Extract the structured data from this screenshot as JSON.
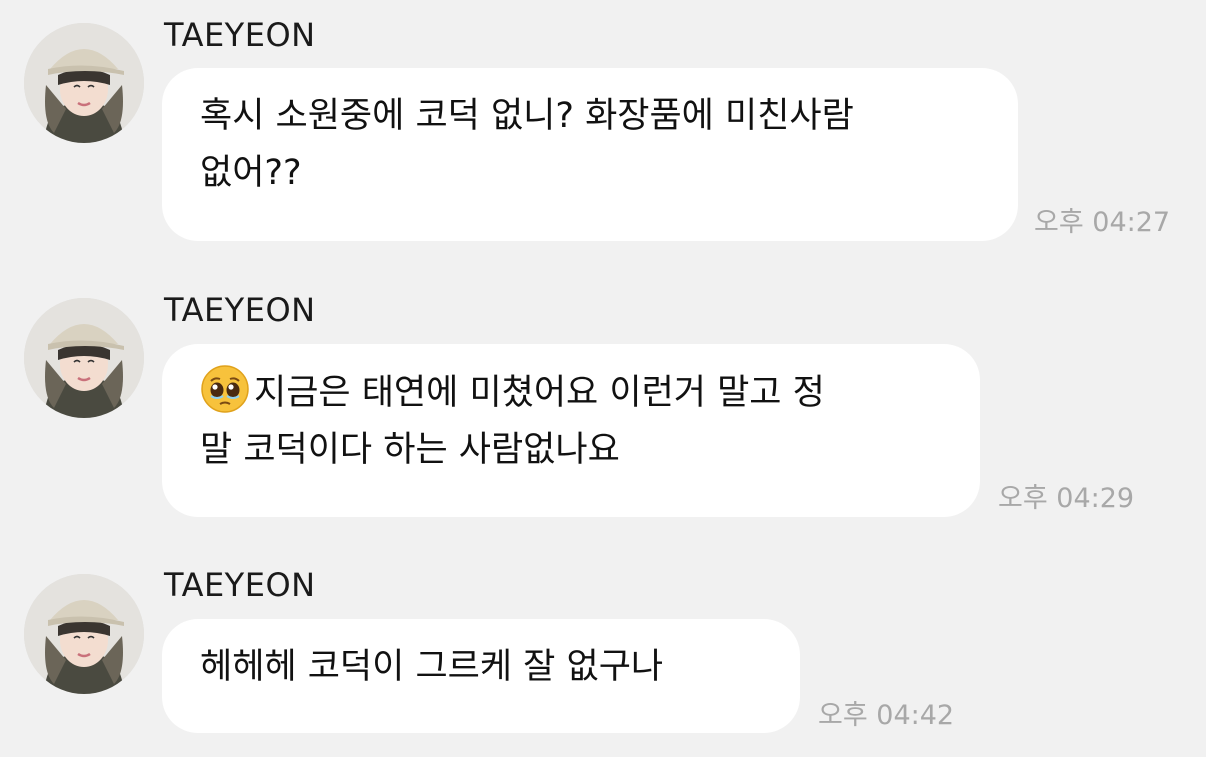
{
  "messages": [
    {
      "sender": "TAEYEON",
      "lines": [
        "혹시 소원중에 코덕 없니? 화장품에 미친사람",
        "없어??"
      ],
      "time": "오후 04:27"
    },
    {
      "sender": "TAEYEON",
      "emoji": "pleading-face",
      "lines": [
        "지금은 태연에 미쳤어요 이런거 말고 정",
        "말 코덕이다 하는 사람없나요"
      ],
      "time": "오후 04:29"
    },
    {
      "sender": "TAEYEON",
      "lines": [
        "헤헤헤 코덕이 그르케 잘 없구나"
      ],
      "time": "오후 04:42"
    }
  ],
  "colors": {
    "background": "#f1f1f1",
    "bubble": "#ffffff",
    "timestamp": "#a8a8a8"
  }
}
